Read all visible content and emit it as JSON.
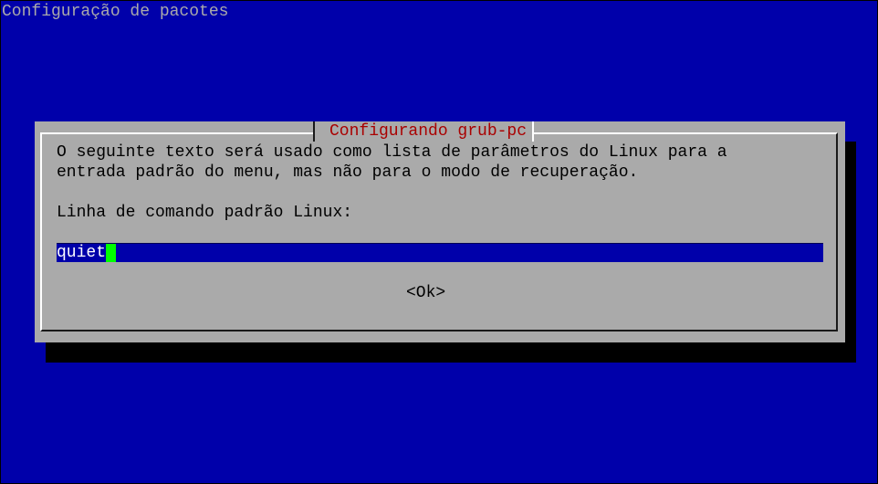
{
  "screen": {
    "backtitle": "Configuração de pacotes"
  },
  "dialog": {
    "title": "Configurando grub-pc",
    "description_line1": "O seguinte texto será usado como lista de parâmetros do Linux para a",
    "description_line2": "entrada padrão do menu, mas não para o modo de recuperação.",
    "prompt": "Linha de comando padrão Linux:",
    "input_value": "quiet",
    "ok_label": "<Ok>"
  },
  "colors": {
    "background": "#0000aa",
    "dialog": "#aaaaaa",
    "title": "#aa0000",
    "cursor": "#00ff00"
  }
}
